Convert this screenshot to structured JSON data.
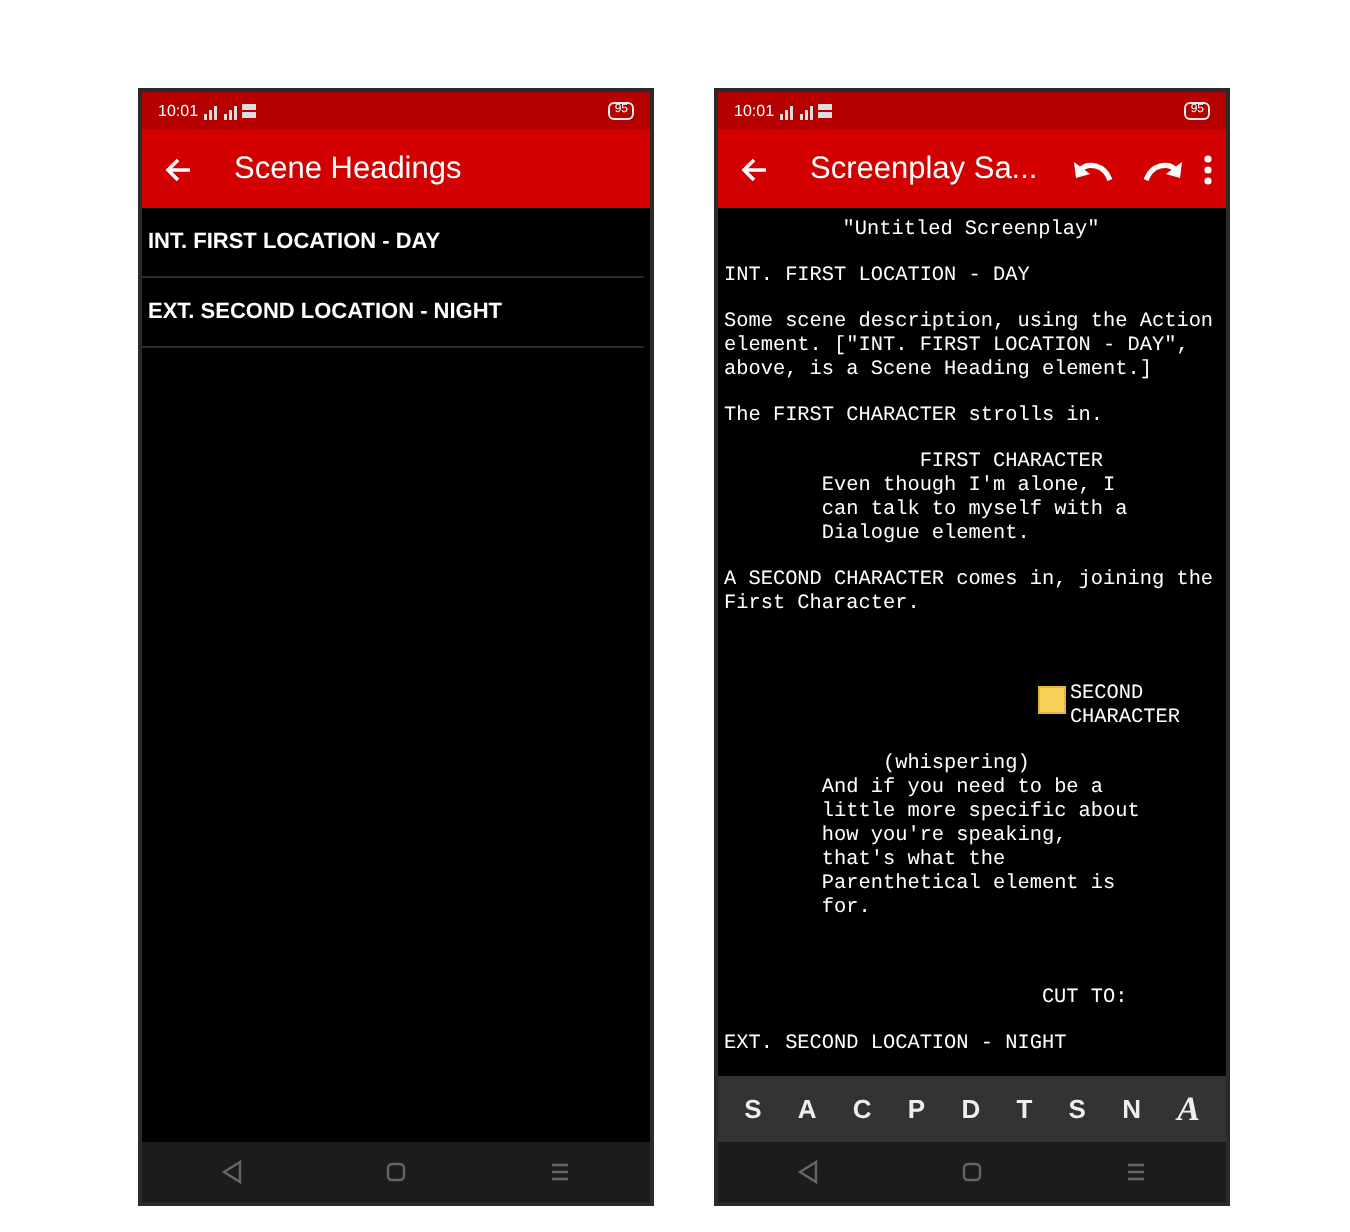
{
  "phones": [
    {
      "status_bar": {
        "time": "10:01",
        "battery": "95"
      },
      "app_bar": {
        "title": "Scene Headings"
      },
      "kind": "list",
      "items": [
        "INT. FIRST LOCATION - DAY",
        "EXT. SECOND LOCATION - NIGHT"
      ]
    },
    {
      "status_bar": {
        "time": "10:01",
        "battery": "95"
      },
      "app_bar": {
        "title": "Screenplay Sa...",
        "actions": [
          {
            "kind": "undo"
          },
          {
            "kind": "redo"
          },
          {
            "kind": "more"
          }
        ]
      },
      "kind": "editor",
      "script": [
        {
          "kind": "title",
          "text": "\"Untitled Screenplay\""
        },
        {
          "kind": "scene",
          "text": "INT. FIRST LOCATION - DAY"
        },
        {
          "kind": "action",
          "text": "Some scene description, using the Action element. [\"INT. FIRST LOCATION - DAY\", above, is a Scene Heading element.]"
        },
        {
          "kind": "action",
          "text": "The FIRST CHARACTER strolls in."
        },
        {
          "kind": "character",
          "text": "FIRST CHARACTER",
          "note": false
        },
        {
          "kind": "dialogue",
          "text": "Even though I'm alone, I can talk to myself with a Dialogue element."
        },
        {
          "kind": "action",
          "text": "A SECOND CHARACTER comes in, joining the First Character."
        },
        {
          "kind": "character",
          "text": "SECOND CHARACTER",
          "note": true
        },
        {
          "kind": "parenthetical",
          "text": "(whispering)"
        },
        {
          "kind": "dialogue",
          "text": "And if you need to be a little more specific about how you're speaking, that's what the Parenthetical element is for."
        },
        {
          "kind": "transition",
          "text": "CUT TO:"
        },
        {
          "kind": "scene",
          "text": "EXT. SECOND LOCATION - NIGHT"
        }
      ],
      "element_keys": [
        {
          "label": "S",
          "italic": false
        },
        {
          "label": "A",
          "italic": false
        },
        {
          "label": "C",
          "italic": false
        },
        {
          "label": "P",
          "italic": false
        },
        {
          "label": "D",
          "italic": false
        },
        {
          "label": "T",
          "italic": false
        },
        {
          "label": "S",
          "italic": false
        },
        {
          "label": "N",
          "italic": false
        },
        {
          "label": "A",
          "italic": true
        }
      ]
    }
  ]
}
